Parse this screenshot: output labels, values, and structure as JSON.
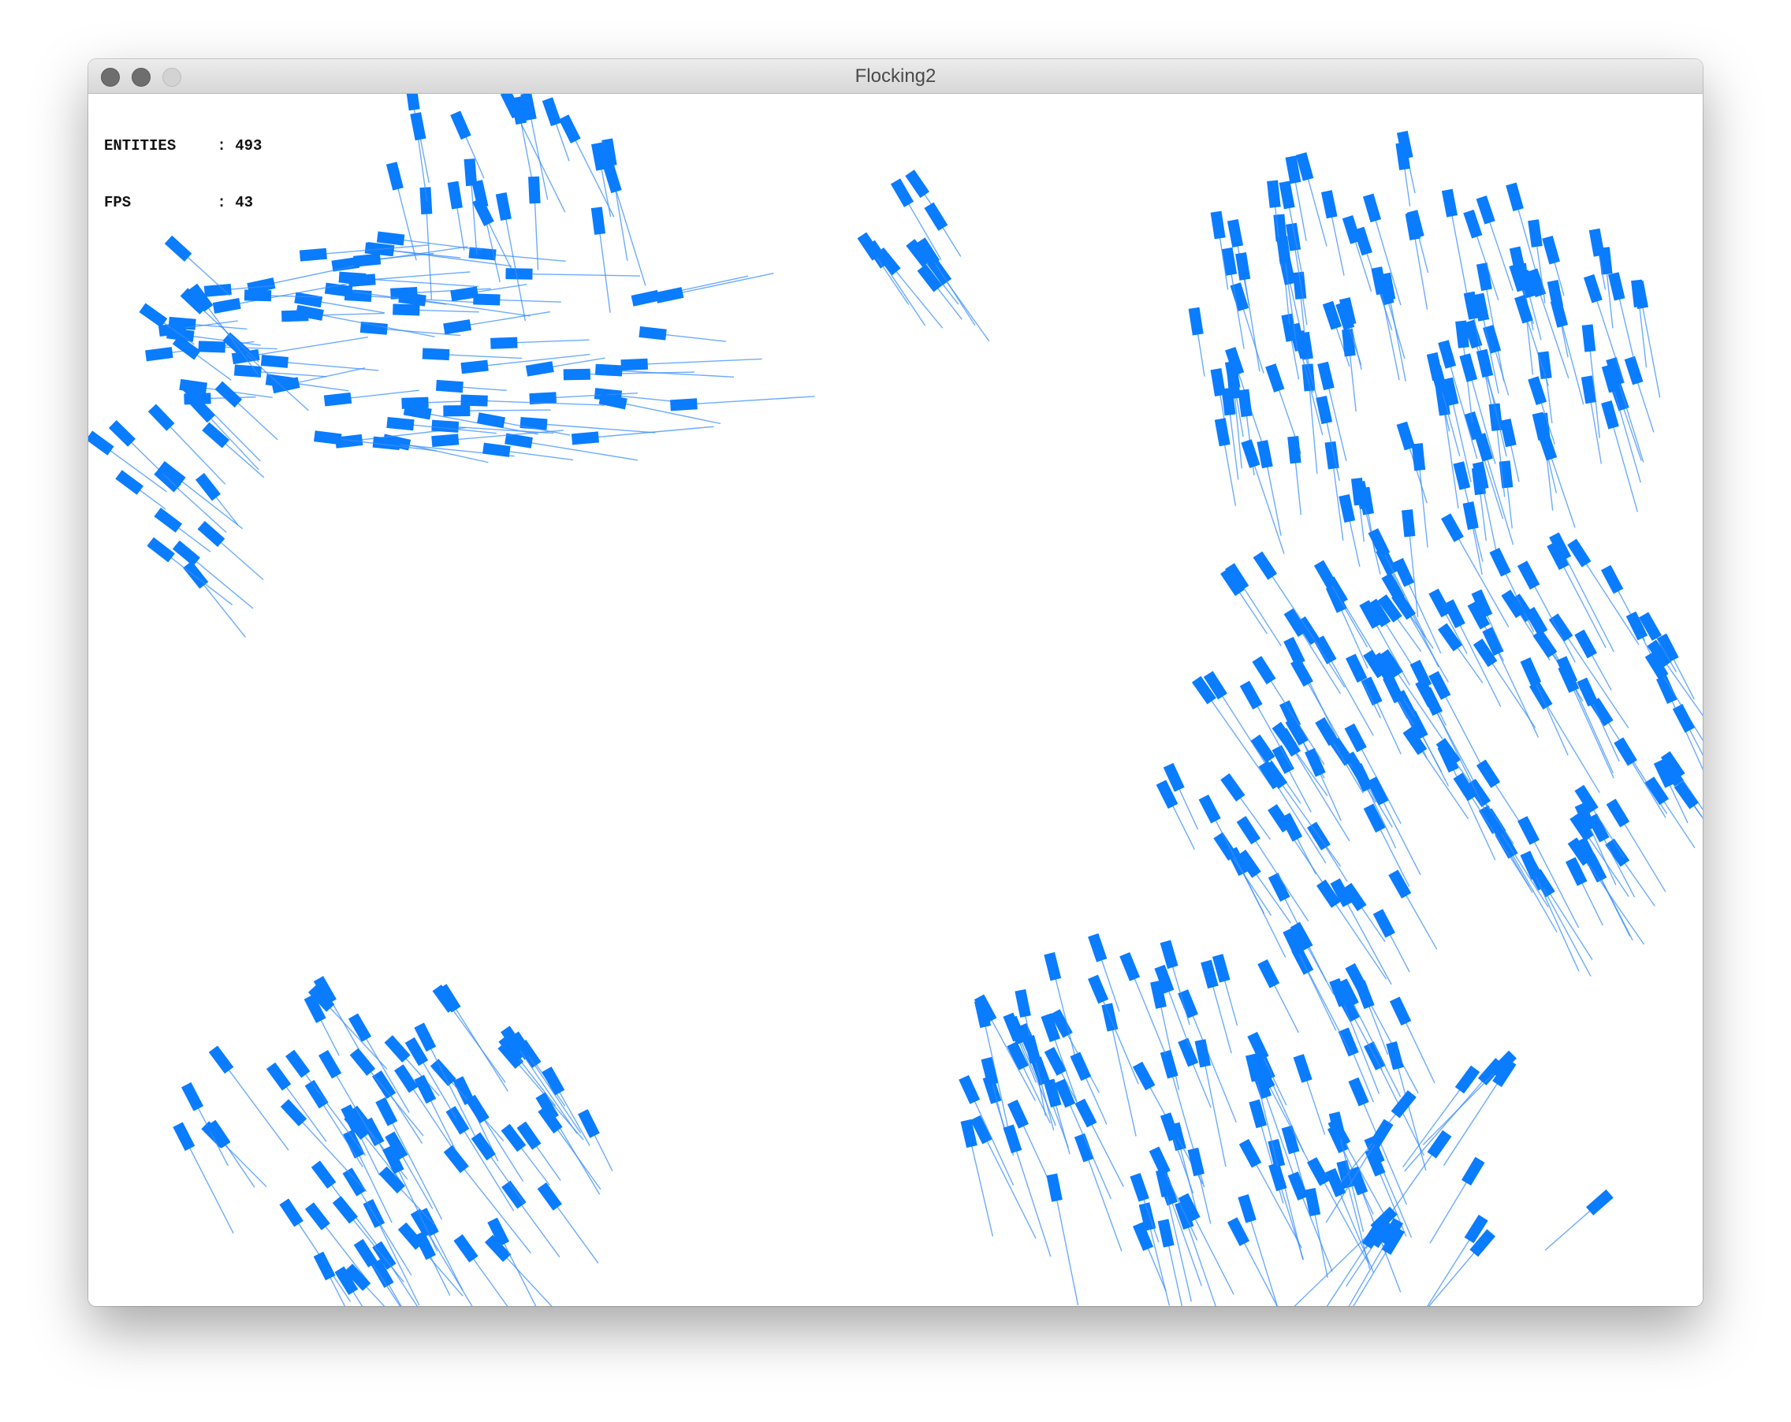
{
  "window": {
    "title": "Flocking2"
  },
  "hud": {
    "entities_label": "ENTITIES",
    "entities_value": "493",
    "fps_label": "FPS",
    "fps_value": "43",
    "separator": ":"
  },
  "colors": {
    "boid": "#0a7cff",
    "trail": "#3b8fff",
    "background": "#ffffff"
  }
}
